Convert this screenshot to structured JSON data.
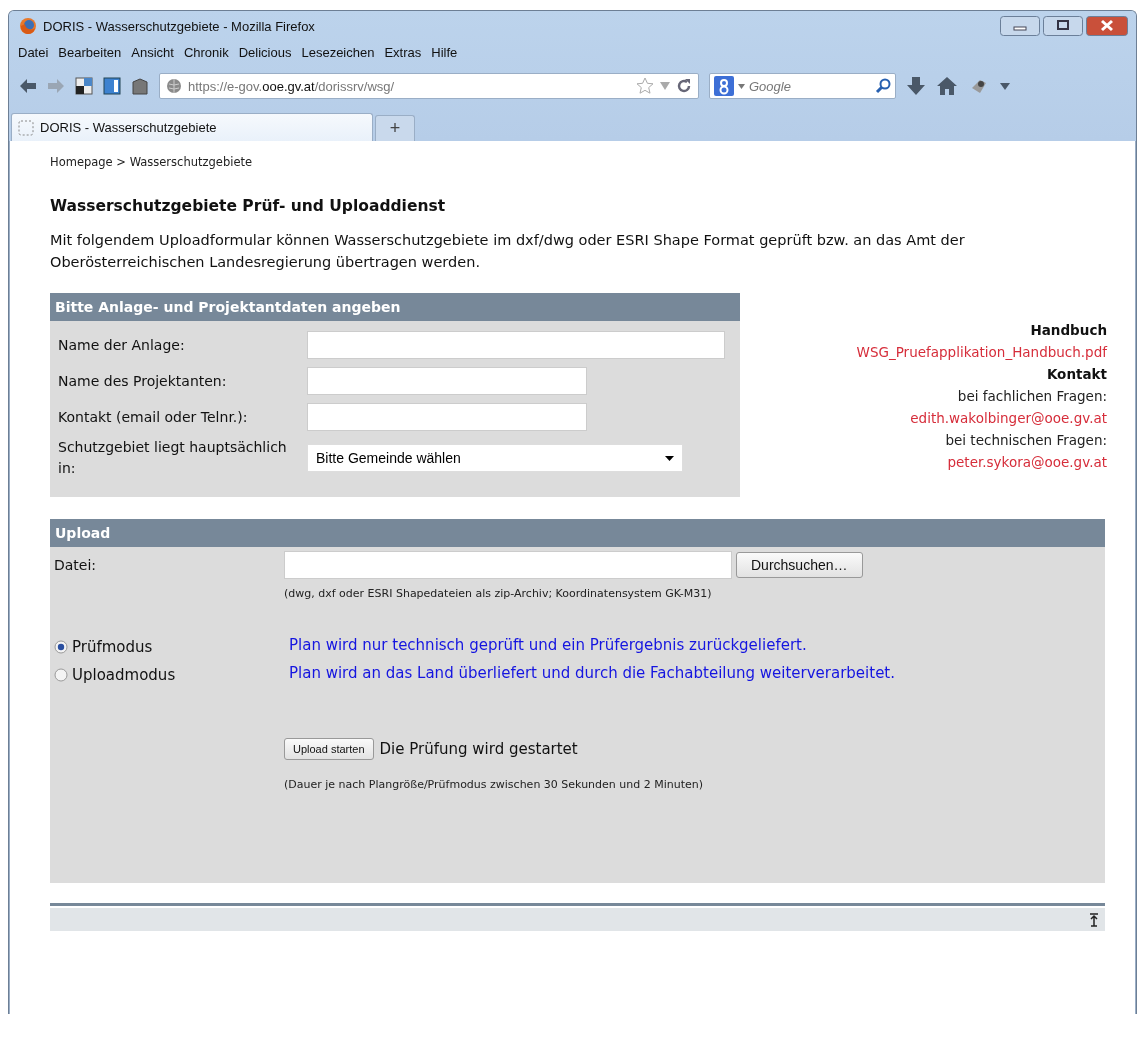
{
  "window": {
    "title": "DORIS - Wasserschutzgebiete - Mozilla Firefox"
  },
  "menu": [
    "Datei",
    "Bearbeiten",
    "Ansicht",
    "Chronik",
    "Delicious",
    "Lesezeichen",
    "Extras",
    "Hilfe"
  ],
  "toolbar": {
    "url": "https://e-gov.**ooe.gv.at**/dorissrv/wsg/",
    "search_placeholder": "Google"
  },
  "tabs": [
    {
      "label": "DORIS - Wasserschutzgebiete",
      "selected": true
    }
  ],
  "new_tab": "+",
  "breadcrumb": "Homepage > Wasserschutzgebiete",
  "heading": "Wasserschutzgebiete Prüf- und Uploaddienst",
  "intro": "Mit folgendem Uploadformular können Wasserschutzgebiete im dxf/dwg oder ESRI Shape Format geprüft bzw. an das Amt der Oberösterreichischen Landesregierung übertragen werden.",
  "form": {
    "title": "Bitte Anlage- und Projektantdaten angeben",
    "fields": [
      {
        "label": "Name der Anlage:",
        "kind": "text"
      },
      {
        "label": "Name des Projektanten:",
        "kind": "text"
      },
      {
        "label": "Kontakt (email oder Telnr.):",
        "kind": "text"
      },
      {
        "label": "Schutzgebiet liegt hauptsächlich in:",
        "kind": "select",
        "value": "Bitte Gemeinde wählen"
      }
    ]
  },
  "info": [
    {
      "kind": "heading",
      "text": "Handbuch"
    },
    {
      "kind": "link",
      "text": "WSG_Pruefapplikation_Handbuch.pdf"
    },
    {
      "kind": "heading",
      "text": "Kontakt"
    },
    {
      "kind": "text",
      "text": "bei fachlichen Fragen:"
    },
    {
      "kind": "link",
      "text": "edith.wakolbinger@ooe.gv.at"
    },
    {
      "kind": "text",
      "text": "bei technischen Fragen:"
    },
    {
      "kind": "link",
      "text": "peter.sykora@ooe.gv.at"
    }
  ],
  "upload": {
    "title": "Upload",
    "file_label": "Datei:",
    "browse_button": "Durchsuchen…",
    "hint": "(dwg, dxf oder ESRI Shapedateien als zip-Archiv; Koordinatensystem GK-M31)",
    "modes": [
      {
        "label": "Prüfmodus",
        "selected": true,
        "description": "Plan wird nur technisch geprüft und ein Prüfergebnis zurückgeliefert."
      },
      {
        "label": "Uploadmodus",
        "selected": false,
        "description": "Plan wird an das Land überliefert und durch die Fachabteilung weiterverarbeitet."
      }
    ],
    "start_button": "Upload starten",
    "start_note": "Die Prüfung wird gestartet",
    "duration_note": "(Dauer je nach Plangröße/Prüfmodus zwischen 30 Sekunden und 2 Minuten)"
  }
}
